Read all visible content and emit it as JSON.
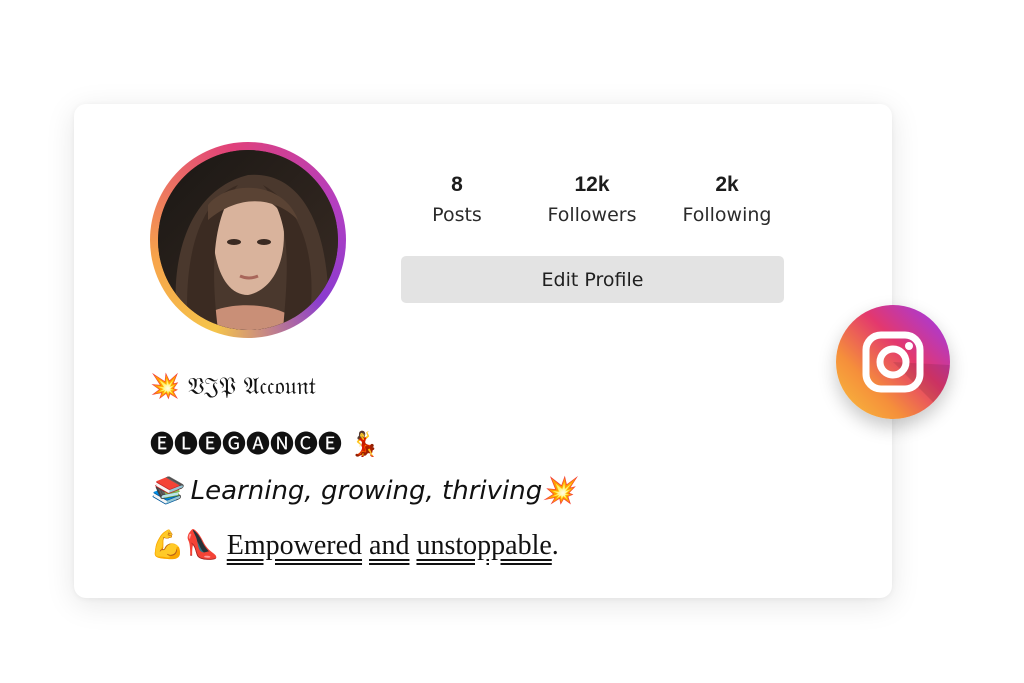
{
  "profile": {
    "stats": [
      {
        "value": "8",
        "label": "Posts"
      },
      {
        "value": "12k",
        "label": "Followers"
      },
      {
        "value": "2k",
        "label": "Following"
      }
    ],
    "edit_button_label": "Edit Profile"
  },
  "bio": {
    "line1_emoji": "💥",
    "line1_text": "𝔙𝔍𝔓 𝔄𝔠𝔠𝔬𝔲𝔫𝔱",
    "line2_text": "🅔🅛🅔🅖🅐🅝🅒🅔",
    "line2_emoji": "💃",
    "line3_emoji": "📚",
    "line3_text": "Learning, growing, thriving",
    "line3_emoji_end": "💥",
    "line4_emoji": "💪👠",
    "line4_words": [
      "Empowered",
      "and",
      "unstoppable"
    ],
    "line4_punct": "."
  },
  "icons": {
    "avatar": "profile-photo",
    "instagram": "instagram-logo-icon"
  },
  "colors": {
    "card_bg": "#ffffff",
    "button_bg": "#e3e3e3",
    "ring_gradient": [
      "#f5c44a",
      "#e0407a",
      "#8a3ccf"
    ]
  }
}
